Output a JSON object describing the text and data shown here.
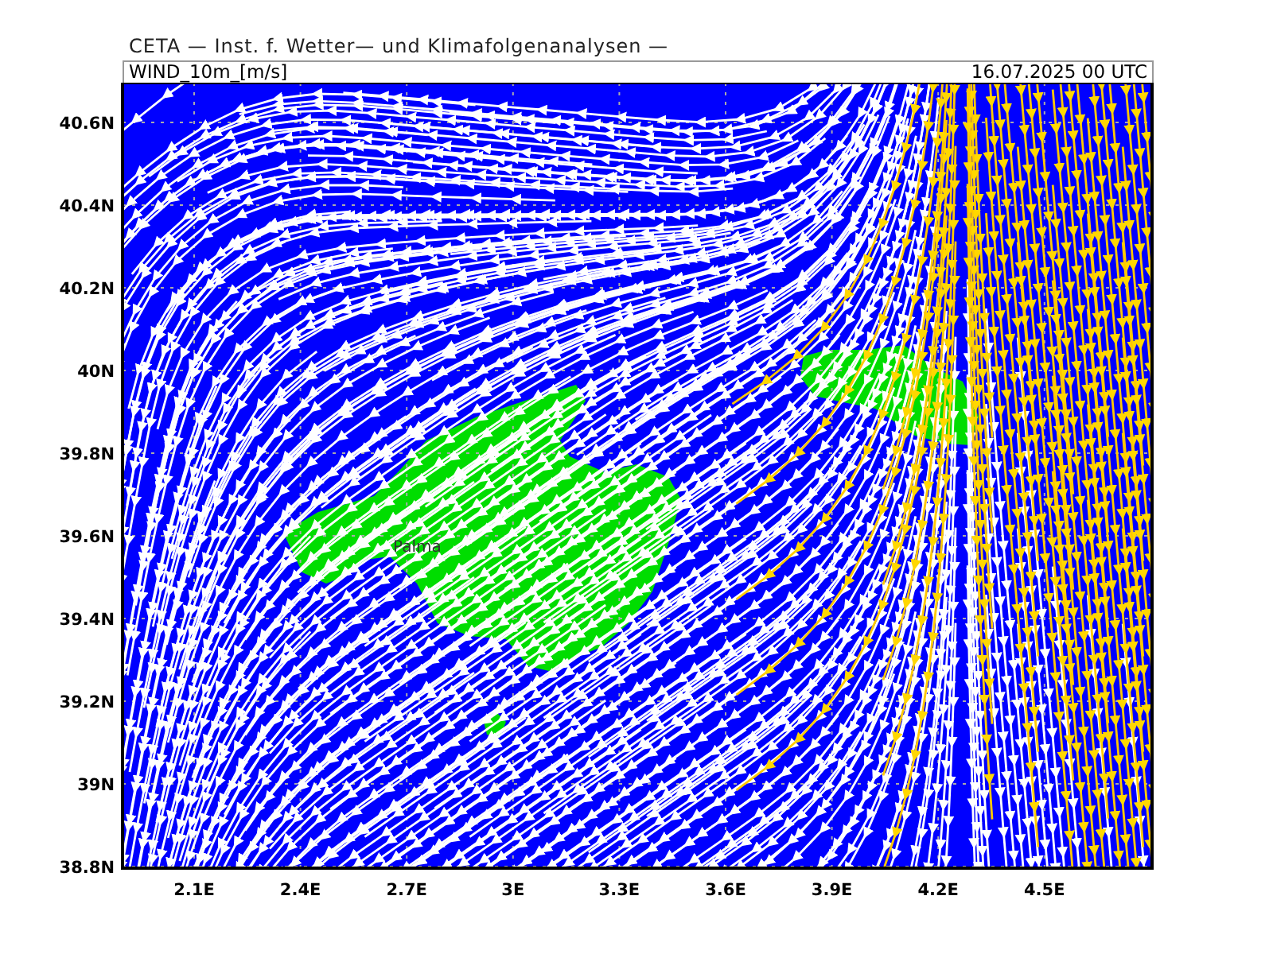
{
  "header": "CETA — Inst. f. Wetter— und Klimafolgenanalysen —",
  "plot": {
    "field_label": "WIND_10m_[m/s]",
    "valid_time": "16.07.2025 00 UTC"
  },
  "map": {
    "place_labels": [
      "Palma"
    ],
    "latitude_labels": [
      "40.6N",
      "40.4N",
      "40.2N",
      "40N",
      "39.8N",
      "39.6N",
      "39.4N",
      "39.2N",
      "39N",
      "38.8N"
    ],
    "longitude_labels": [
      "2.1E",
      "2.4E",
      "2.7E",
      "3E",
      "3.3E",
      "3.6E",
      "3.9E",
      "4.2E",
      "4.5E"
    ]
  }
}
